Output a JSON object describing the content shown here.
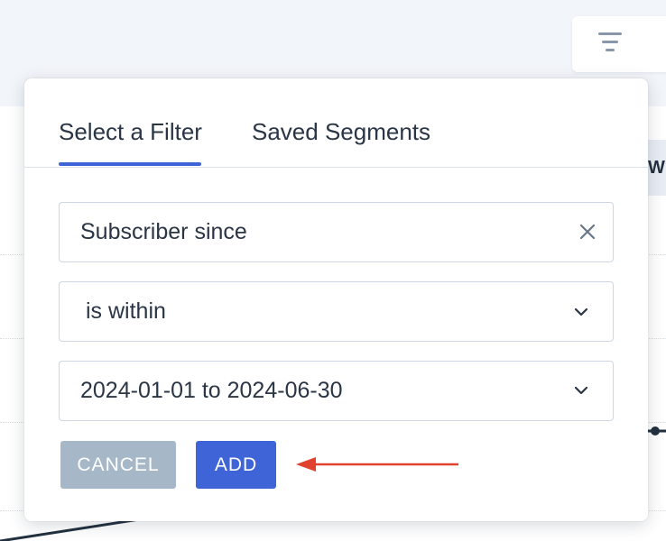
{
  "filter_popover": {
    "tabs": [
      {
        "label": "Select a Filter",
        "active": true
      },
      {
        "label": "Saved Segments",
        "active": false
      }
    ],
    "field_value": "Subscriber since",
    "operator_value": "is within",
    "date_range_value": "2024-01-01 to 2024-06-30",
    "cancel_label": "CANCEL",
    "add_label": "ADD"
  },
  "background": {
    "tab_stub_text": "WI"
  },
  "colors": {
    "accent": "#3e64d8",
    "cancel_disabled": "#a6b8c8",
    "annotation_arrow": "#e0422f"
  },
  "icons": {
    "filter_button": "filter-lines-icon",
    "field_clear": "close-icon",
    "operator_dropdown": "chevron-down-icon",
    "date_dropdown": "chevron-down-icon"
  }
}
